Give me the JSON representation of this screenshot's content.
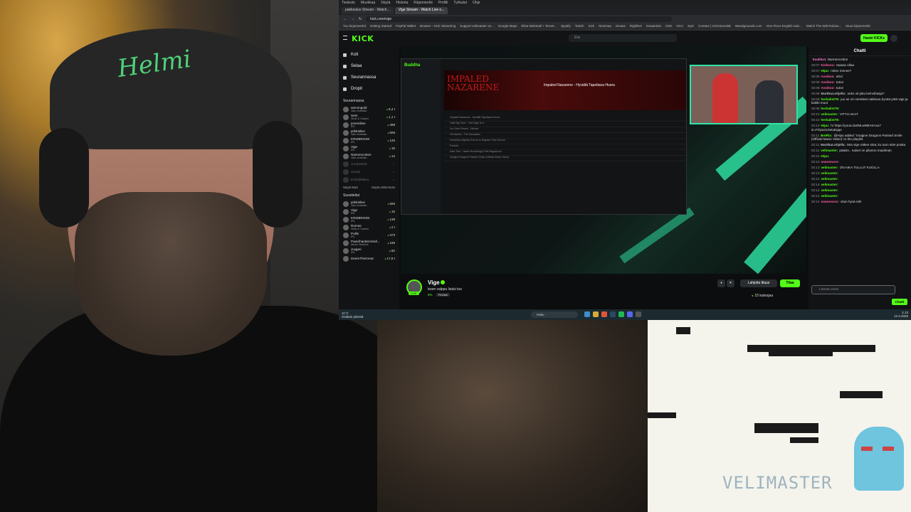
{
  "game": {
    "logo_text": "VELIMASTER"
  },
  "cap": {
    "logo_text": "Helmi"
  },
  "browser": {
    "menu": [
      "Tiedosto",
      "Muokkaa",
      "Näytä",
      "Historia",
      "Kirjanmerkit",
      "Profiili",
      "Työkalut",
      "Ohje"
    ],
    "tabs": [
      "pakkoulus Stream - Watch...",
      "Vige Stream - Watch Live o..."
    ],
    "address": "kick.com/vige",
    "bookmarks": [
      "Tuo kirjanmerkit",
      "Getting Started",
      "PayPal Wallet",
      "Browse – Kick Streaming",
      "Support velimaster on...",
      "Google Maps",
      "Elisa Webmail + Tervet...",
      "Spotify",
      "Twitch",
      "Kick",
      "Nimimaa",
      "Smaas",
      "Rightbot",
      "Smaaninla",
      "CDK",
      "GCC",
      "Epic",
      "Contact | GOGstorelab",
      "Weedgrounds.com",
      "One Piece English Sub...",
      "Watch The Witt Robots...",
      "Muut kirjanmerkit"
    ]
  },
  "kick": {
    "logo": "KICK",
    "search_placeholder": "Etsi",
    "login": "Hanki KICKs",
    "nav": [
      "Koti",
      "Selaa",
      "Seurannassa",
      "Dropit"
    ],
    "following_heading": "Seurannassa",
    "following": [
      {
        "name": "asmongold",
        "sub": "Vain chattailu",
        "viewers": "8,4 t",
        "offline": false
      },
      {
        "name": "Sem",
        "sub": "Slots & Casino",
        "viewers": "1,1 t",
        "offline": false
      },
      {
        "name": "jonemiliee",
        "sub": "IRL",
        "viewers": "498",
        "offline": false
      },
      {
        "name": "pirkkislive",
        "sub": "Vain chattailu",
        "viewers": "506",
        "offline": false
      },
      {
        "name": "KRIZBROIDI",
        "sub": "IRL",
        "viewers": "125",
        "offline": false
      },
      {
        "name": "Vige",
        "sub": "IRL",
        "viewers": "15",
        "offline": false
      },
      {
        "name": "Nanneocotton",
        "sub": "Vain chattailu",
        "viewers": "13",
        "offline": false
      },
      {
        "name": "Jumpstarttt",
        "sub": "",
        "viewers": "",
        "offline": true
      },
      {
        "name": "Suudu",
        "sub": "",
        "viewers": "",
        "offline": true
      },
      {
        "name": "Enhafdlakes",
        "sub": "",
        "viewers": "",
        "offline": true
      }
    ],
    "show_more": "Näytä lisää",
    "show_less": "Näytä vähemmän",
    "recommended_heading": "Suositellut",
    "recommended": [
      {
        "name": "pirkkislive",
        "sub": "Vain chattailu",
        "viewers": "506"
      },
      {
        "name": "Vige",
        "sub": "IRL",
        "viewers": "15"
      },
      {
        "name": "KRIZBROIDI",
        "sub": "IRL",
        "viewers": "139"
      },
      {
        "name": "Romee",
        "sub": "Slots & Casino",
        "viewers": "2 t"
      },
      {
        "name": "Pullis",
        "sub": "IRL",
        "viewers": "373"
      },
      {
        "name": "PaaViharaboVirall...",
        "sub": "Music Stations",
        "viewers": "165"
      },
      {
        "name": "Juujpei",
        "sub": "IRL",
        "viewers": "62"
      },
      {
        "name": "DeemTheGreat",
        "sub": "",
        "viewers": "17,8 t"
      }
    ],
    "inner_page": {
      "logo": "Buddha",
      "band_text": "IMPALED NAZARENE",
      "video_title": "Impaled Nazarene - Hyvältä Tapettava Huora",
      "rows": [
        "Impaled Nazarene - Hyvältä Tapettava Huora",
        "Little Big Town - The Edge Is In",
        "Ice Cube Dream - Vibrace",
        "Hit Maiden - The Mountains",
        "Kristarika (Mykkä) Sorrow Is Brighter Than Sorrow",
        "Pontant",
        "Dark Tide - Hazen Boundingly Feat Ragnarook",
        "Imagine Dragons Painted Smile (Official Music Video)"
      ]
    },
    "streamer": {
      "name": "Vige",
      "title": "team valppu lisäsi tuo",
      "category": "IRL",
      "tag": "Finnish",
      "live": "LIVE",
      "subscribe": "Lahjoita tilaus",
      "follow": "Tilaa",
      "viewers": "15 katsojaa"
    },
    "chat": {
      "title": "Chatti",
      "input_placeholder": "Lähetä viesti",
      "send": "Chatti",
      "messages": [
        {
          "t": "",
          "u": "kuukku1",
          "c": "#ff7ad9",
          "m": "Nanneocotton"
        },
        {
          "t": "02:07",
          "u": "Kiskooo:",
          "c": "#ff5fa8",
          "m": "taaaax ollaa"
        },
        {
          "t": "02:07",
          "u": "Hipu:",
          "c": "#53fc18",
          "m": "miten menee?"
        },
        {
          "t": "02:08",
          "u": "Assikoo:",
          "c": "#ff5fa8",
          "m": "ahol"
        },
        {
          "t": "02:08",
          "u": "Assikoo:",
          "c": "#ff5fa8",
          "m": "tuton"
        },
        {
          "t": "02:08",
          "u": "Assikoo:",
          "c": "#ff5fa8",
          "m": "tuton"
        },
        {
          "t": "02:08",
          "u": "MarkkuLohjella:",
          "c": "#bbbbbb",
          "m": "onko vit joku keinvihasja?"
        },
        {
          "t": "02:08",
          "u": "herbalist78:",
          "c": "#53fc18",
          "m": "juu se on mentävä nakkuun,hyvää yötä vige ja kaikki muut"
        },
        {
          "t": "02:09",
          "u": "herbalist78:",
          "c": "#53fc18",
          "m": ""
        },
        {
          "t": "02:10",
          "u": "velimaster:",
          "c": "#53fc18",
          "m": "VITTU AKAT"
        },
        {
          "t": "02:10",
          "u": "herbalist78:",
          "c": "#53fc18",
          "m": ""
        },
        {
          "t": "02:10",
          "u": "Hipu:",
          "c": "#53fc18",
          "m": "hr https://youtu.be/MLw9MAKAxu?si=FOpazu2wtuEgqe"
        },
        {
          "t": "02:11",
          "u": "BotRix:",
          "c": "#53fc18",
          "m": "@Hipu added: 'Imagine Dragons Painted Smile (Official Music Video)' to the playlist."
        },
        {
          "t": "02:11",
          "u": "MarkkuLohjella:",
          "c": "#bbbbbb",
          "m": "Mut vige näkee sinä, ku tuon sitte postta"
        },
        {
          "t": "02:11",
          "u": "velimaster:",
          "c": "#53fc18",
          "m": "pääsin.. naiset on pilannu maailman"
        },
        {
          "t": "02:12",
          "u": "Hipu:",
          "c": "#53fc18",
          "m": ""
        },
        {
          "t": "02:12",
          "u": "nanonooro:",
          "c": "#ff5fa8",
          "m": ""
        },
        {
          "t": "02:13",
          "u": "velimaster:",
          "c": "#53fc18",
          "m": "ON AIKA TULLUT KUOLLA"
        },
        {
          "t": "02:13",
          "u": "velimaster:",
          "c": "#53fc18",
          "m": ""
        },
        {
          "t": "02:14",
          "u": "velimaster:",
          "c": "#53fc18",
          "m": ""
        },
        {
          "t": "02:14",
          "u": "velimaster:",
          "c": "#53fc18",
          "m": ""
        },
        {
          "t": "02:14",
          "u": "velimaster:",
          "c": "#53fc18",
          "m": ""
        },
        {
          "t": "02:14",
          "u": "velimaster:",
          "c": "#53fc18",
          "m": ""
        },
        {
          "t": "02:14",
          "u": "nanonooro:",
          "c": "#ff5fa8",
          "m": "vitun hyvä reili"
        }
      ]
    }
  },
  "taskbar": {
    "weather_temp": "11°C",
    "weather_desc": "Osittain pilvistä",
    "search": "Haku",
    "time": "2.13",
    "date": "12.4.2025"
  }
}
